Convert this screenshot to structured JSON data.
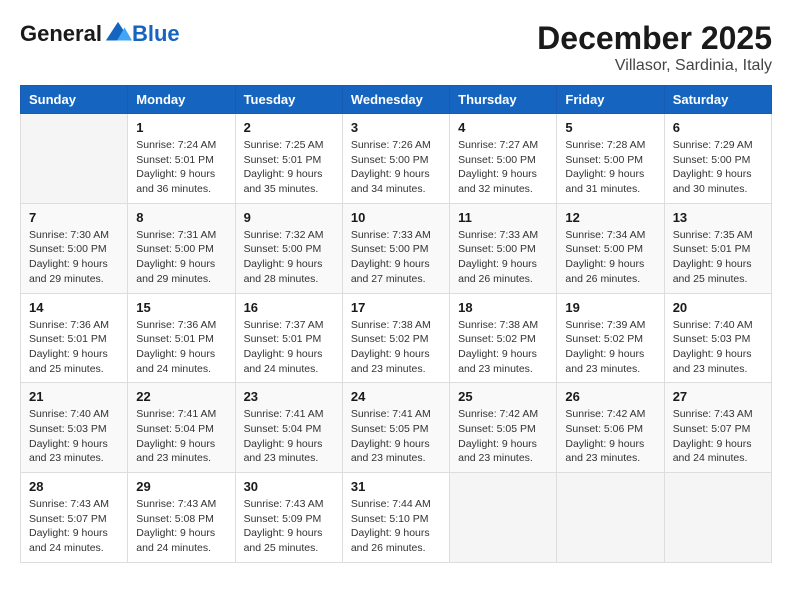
{
  "header": {
    "logo_general": "General",
    "logo_blue": "Blue",
    "month": "December 2025",
    "location": "Villasor, Sardinia, Italy"
  },
  "days_of_week": [
    "Sunday",
    "Monday",
    "Tuesday",
    "Wednesday",
    "Thursday",
    "Friday",
    "Saturday"
  ],
  "weeks": [
    [
      {
        "day": "",
        "info": ""
      },
      {
        "day": "1",
        "info": "Sunrise: 7:24 AM\nSunset: 5:01 PM\nDaylight: 9 hours\nand 36 minutes."
      },
      {
        "day": "2",
        "info": "Sunrise: 7:25 AM\nSunset: 5:01 PM\nDaylight: 9 hours\nand 35 minutes."
      },
      {
        "day": "3",
        "info": "Sunrise: 7:26 AM\nSunset: 5:00 PM\nDaylight: 9 hours\nand 34 minutes."
      },
      {
        "day": "4",
        "info": "Sunrise: 7:27 AM\nSunset: 5:00 PM\nDaylight: 9 hours\nand 32 minutes."
      },
      {
        "day": "5",
        "info": "Sunrise: 7:28 AM\nSunset: 5:00 PM\nDaylight: 9 hours\nand 31 minutes."
      },
      {
        "day": "6",
        "info": "Sunrise: 7:29 AM\nSunset: 5:00 PM\nDaylight: 9 hours\nand 30 minutes."
      }
    ],
    [
      {
        "day": "7",
        "info": "Sunrise: 7:30 AM\nSunset: 5:00 PM\nDaylight: 9 hours\nand 29 minutes."
      },
      {
        "day": "8",
        "info": "Sunrise: 7:31 AM\nSunset: 5:00 PM\nDaylight: 9 hours\nand 29 minutes."
      },
      {
        "day": "9",
        "info": "Sunrise: 7:32 AM\nSunset: 5:00 PM\nDaylight: 9 hours\nand 28 minutes."
      },
      {
        "day": "10",
        "info": "Sunrise: 7:33 AM\nSunset: 5:00 PM\nDaylight: 9 hours\nand 27 minutes."
      },
      {
        "day": "11",
        "info": "Sunrise: 7:33 AM\nSunset: 5:00 PM\nDaylight: 9 hours\nand 26 minutes."
      },
      {
        "day": "12",
        "info": "Sunrise: 7:34 AM\nSunset: 5:00 PM\nDaylight: 9 hours\nand 26 minutes."
      },
      {
        "day": "13",
        "info": "Sunrise: 7:35 AM\nSunset: 5:01 PM\nDaylight: 9 hours\nand 25 minutes."
      }
    ],
    [
      {
        "day": "14",
        "info": "Sunrise: 7:36 AM\nSunset: 5:01 PM\nDaylight: 9 hours\nand 25 minutes."
      },
      {
        "day": "15",
        "info": "Sunrise: 7:36 AM\nSunset: 5:01 PM\nDaylight: 9 hours\nand 24 minutes."
      },
      {
        "day": "16",
        "info": "Sunrise: 7:37 AM\nSunset: 5:01 PM\nDaylight: 9 hours\nand 24 minutes."
      },
      {
        "day": "17",
        "info": "Sunrise: 7:38 AM\nSunset: 5:02 PM\nDaylight: 9 hours\nand 23 minutes."
      },
      {
        "day": "18",
        "info": "Sunrise: 7:38 AM\nSunset: 5:02 PM\nDaylight: 9 hours\nand 23 minutes."
      },
      {
        "day": "19",
        "info": "Sunrise: 7:39 AM\nSunset: 5:02 PM\nDaylight: 9 hours\nand 23 minutes."
      },
      {
        "day": "20",
        "info": "Sunrise: 7:40 AM\nSunset: 5:03 PM\nDaylight: 9 hours\nand 23 minutes."
      }
    ],
    [
      {
        "day": "21",
        "info": "Sunrise: 7:40 AM\nSunset: 5:03 PM\nDaylight: 9 hours\nand 23 minutes."
      },
      {
        "day": "22",
        "info": "Sunrise: 7:41 AM\nSunset: 5:04 PM\nDaylight: 9 hours\nand 23 minutes."
      },
      {
        "day": "23",
        "info": "Sunrise: 7:41 AM\nSunset: 5:04 PM\nDaylight: 9 hours\nand 23 minutes."
      },
      {
        "day": "24",
        "info": "Sunrise: 7:41 AM\nSunset: 5:05 PM\nDaylight: 9 hours\nand 23 minutes."
      },
      {
        "day": "25",
        "info": "Sunrise: 7:42 AM\nSunset: 5:05 PM\nDaylight: 9 hours\nand 23 minutes."
      },
      {
        "day": "26",
        "info": "Sunrise: 7:42 AM\nSunset: 5:06 PM\nDaylight: 9 hours\nand 23 minutes."
      },
      {
        "day": "27",
        "info": "Sunrise: 7:43 AM\nSunset: 5:07 PM\nDaylight: 9 hours\nand 24 minutes."
      }
    ],
    [
      {
        "day": "28",
        "info": "Sunrise: 7:43 AM\nSunset: 5:07 PM\nDaylight: 9 hours\nand 24 minutes."
      },
      {
        "day": "29",
        "info": "Sunrise: 7:43 AM\nSunset: 5:08 PM\nDaylight: 9 hours\nand 24 minutes."
      },
      {
        "day": "30",
        "info": "Sunrise: 7:43 AM\nSunset: 5:09 PM\nDaylight: 9 hours\nand 25 minutes."
      },
      {
        "day": "31",
        "info": "Sunrise: 7:44 AM\nSunset: 5:10 PM\nDaylight: 9 hours\nand 26 minutes."
      },
      {
        "day": "",
        "info": ""
      },
      {
        "day": "",
        "info": ""
      },
      {
        "day": "",
        "info": ""
      }
    ]
  ]
}
